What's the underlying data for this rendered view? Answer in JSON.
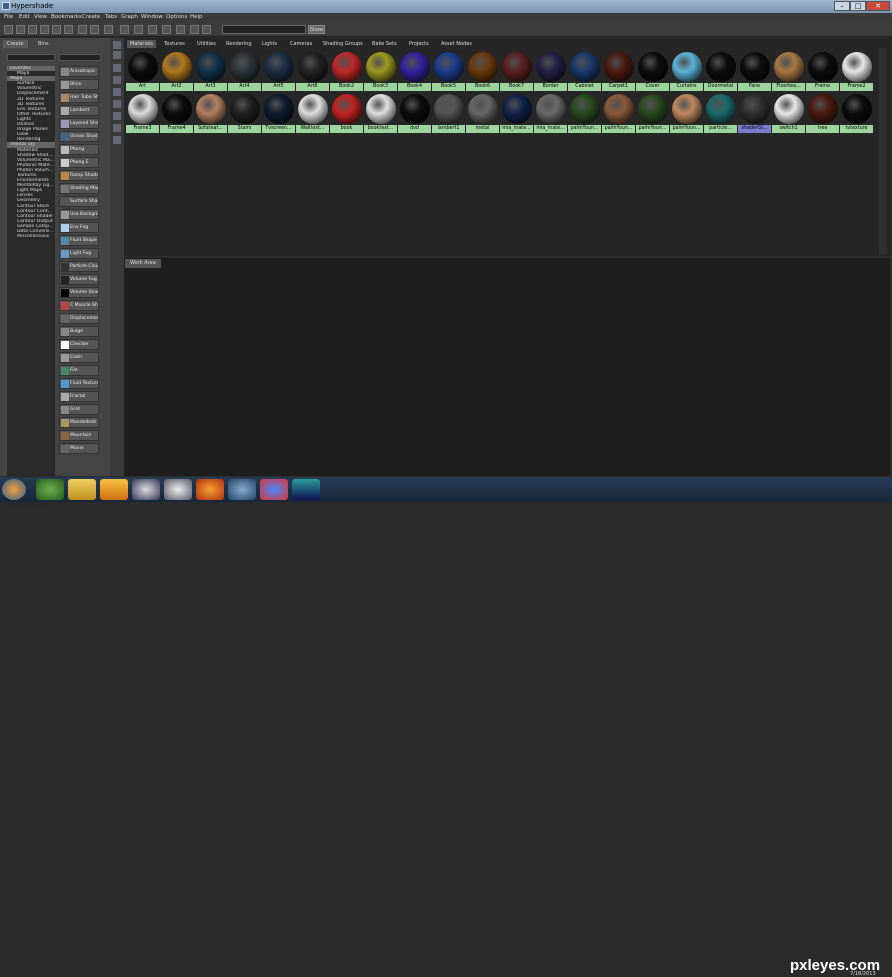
{
  "window": {
    "title": "Hypershade"
  },
  "menus": [
    "File",
    "Edit",
    "View",
    "Bookmarks",
    "Create",
    "Tabs",
    "Graph",
    "Window",
    "Options",
    "Help"
  ],
  "toolbar": {
    "show_label": "Show"
  },
  "left_tabs": [
    "Create",
    "Bins"
  ],
  "tree": [
    "Favorites",
    "Maya",
    "Maya",
    "Surface",
    "Volumetric",
    "Displacement",
    "2D Textures",
    "3D Textures",
    "Env Textures",
    "Other Textures",
    "Lights",
    "Utilities",
    "Image Planes",
    "Glow",
    "Rendering",
    "mental ray",
    "Materials",
    "Shadow Shad...",
    "Volumetric Ma...",
    "Photonic Mate...",
    "Photon Volum...",
    "Textures",
    "Environments",
    "MentalRay Lig...",
    "Light Maps",
    "Lenses",
    "Geometry",
    "Contour Store",
    "Contour Cont...",
    "Contour Shader",
    "Contour Output",
    "Sample Comp...",
    "Data Conversi...",
    "Miscellaneous"
  ],
  "tree_headers": [
    0,
    2,
    15
  ],
  "nodes": [
    "Anisotropic",
    "Blinn",
    "Hair Tube Shader",
    "Lambert",
    "Layered Shader",
    "Ocean Shader",
    "Phong",
    "Phong E",
    "Ramp Shader",
    "Shading Map",
    "Surface Shader",
    "Use Background",
    "Env Fog",
    "Fluid Shape",
    "Light Fog",
    "Particle Cloud",
    "Volume Fog",
    "Volume Shader",
    "C Muscle Shader",
    "Displacement",
    "Bulge",
    "Checker",
    "Cloth",
    "File",
    "Fluid Texture 2D",
    "Fractal",
    "Grid",
    "Mandelbrot",
    "Mountain",
    "Movie"
  ],
  "top_tabs": [
    "Materials",
    "Textures",
    "Utilities",
    "Rendering",
    "Lights",
    "Cameras",
    "Shading Groups",
    "Bake Sets",
    "Projects",
    "Asset Nodes"
  ],
  "swatches_row1": [
    {
      "label": "Art",
      "color": "#0d0d0d"
    },
    {
      "label": "Art2",
      "color": "#b07a1c"
    },
    {
      "label": "Art3",
      "color": "#12314a"
    },
    {
      "label": "Art4",
      "color": "#2c3338"
    },
    {
      "label": "Art5",
      "color": "#1d2f46"
    },
    {
      "label": "Art6",
      "color": "#222"
    },
    {
      "label": "Book2",
      "color": "#c0282a"
    },
    {
      "label": "Book3",
      "color": "#9c9a20"
    },
    {
      "label": "Book4",
      "color": "#3522a0"
    },
    {
      "label": "Book5",
      "color": "#1c3d8c"
    },
    {
      "label": "Book6",
      "color": "#6a3a0e"
    },
    {
      "label": "Book7",
      "color": "#5a1f1f"
    },
    {
      "label": "Border",
      "color": "#242046"
    },
    {
      "label": "Cabinet",
      "color": "#1a3a6c"
    },
    {
      "label": "Carpet1",
      "color": "#4a1a10"
    },
    {
      "label": "Cover",
      "color": "#0d0d0d"
    },
    {
      "label": "Curtains",
      "color": "#5ab4d8"
    },
    {
      "label": "Doormetal",
      "color": "#0d0d0d"
    },
    {
      "label": "Fane",
      "color": "#0d0d0d"
    },
    {
      "label": "Floortea...",
      "color": "#a87a44"
    },
    {
      "label": "Frame",
      "color": "#0d0d0d"
    },
    {
      "label": "Frame2",
      "color": "#e8e8e8"
    }
  ],
  "swatches_row2": [
    {
      "label": "Frame3",
      "color": "#dcdcdc"
    },
    {
      "label": "Frame4",
      "color": "#0d0d0d"
    },
    {
      "label": "Sofateat...",
      "color": "#b48060"
    },
    {
      "label": "Stairs",
      "color": "#202020"
    },
    {
      "label": "Tvscreen...",
      "color": "#0f1c30"
    },
    {
      "label": "Walltext...",
      "color": "#e0e0e0"
    },
    {
      "label": "book",
      "color": "#c22222"
    },
    {
      "label": "booktext...",
      "color": "#e0e0e0"
    },
    {
      "label": "dvd",
      "color": "#0d0d0d"
    },
    {
      "label": "lambert1",
      "color": "#555"
    },
    {
      "label": "metal",
      "color": "#666"
    },
    {
      "label": "mia_mate...",
      "color": "#10224a"
    },
    {
      "label": "mia_mate...",
      "color": "#6a6a6a"
    },
    {
      "label": "palmYoun...",
      "color": "#2a4a20"
    },
    {
      "label": "palmYoun...",
      "color": "#8a5a3a"
    },
    {
      "label": "palmYoun...",
      "color": "#2a4a20"
    },
    {
      "label": "palmYoun...",
      "color": "#c08a60"
    },
    {
      "label": "particle...",
      "color": "#1a6a6a"
    },
    {
      "label": "shaderGl...",
      "color": "#303030"
    },
    {
      "label": "switch1",
      "color": "#e8e8e8"
    },
    {
      "label": "tree",
      "color": "#4a1a10"
    },
    {
      "label": "tvtexture",
      "color": "#0d0d0d"
    }
  ],
  "selected_swatch": "shaderGl...",
  "work_area_tab": "Work Area",
  "watermark": "pxleyes.com",
  "clock": "7/18/2013"
}
